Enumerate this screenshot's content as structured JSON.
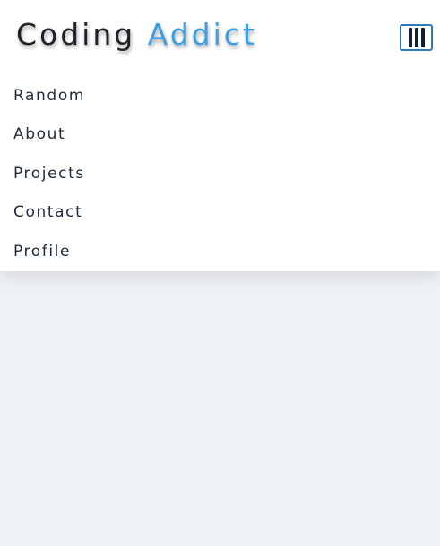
{
  "brand": {
    "word1": "Coding",
    "word2": "Addict",
    "accent_color": "#3d9fe0",
    "text_color": "#1f2328"
  },
  "menu_toggle": {
    "icon": "hamburger-menu-icon",
    "border_color": "#2f79b8"
  },
  "nav": {
    "links": [
      {
        "label": "Random"
      },
      {
        "label": "About"
      },
      {
        "label": "Projects"
      },
      {
        "label": "Contact"
      },
      {
        "label": "Profile"
      }
    ]
  },
  "colors": {
    "page_background": "#eef1f6",
    "navbar_background": "#ffffff",
    "link_color": "#1e2b3a"
  }
}
